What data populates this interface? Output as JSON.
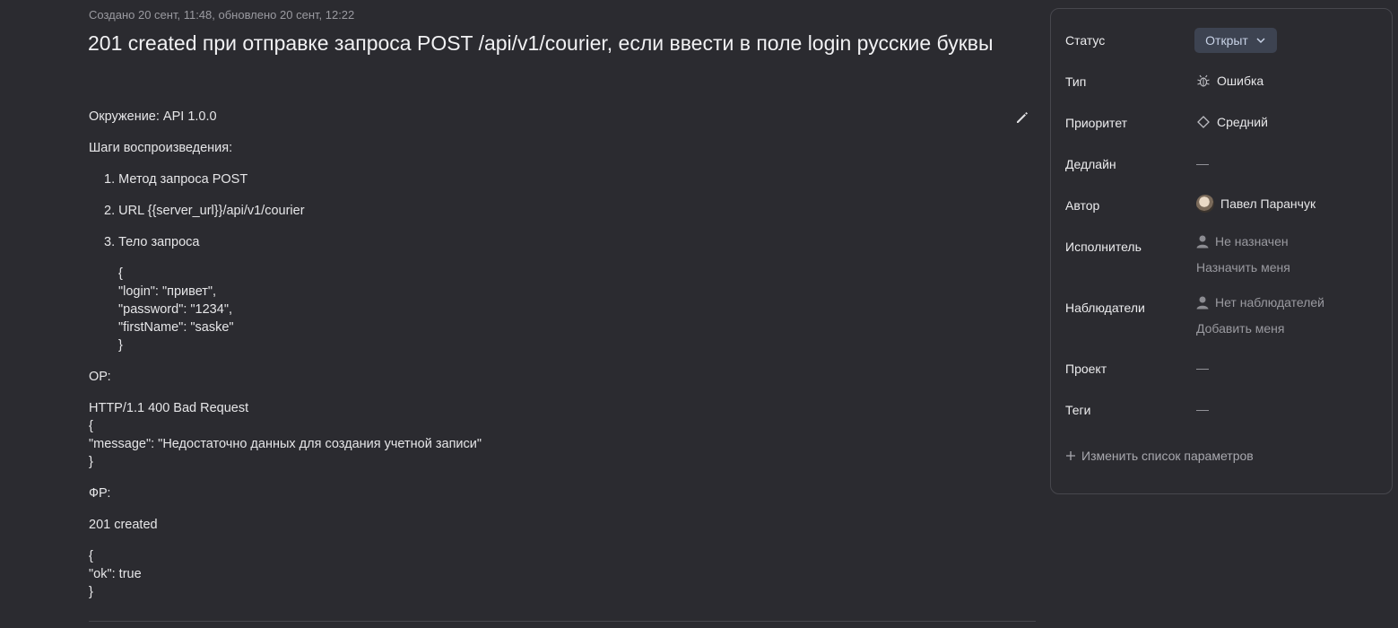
{
  "meta": "Создано 20 сент, 11:48, обновлено 20 сент, 12:22",
  "title": "201 created при отправке запроса POST /api/v1/courier, если ввести в поле login русские буквы",
  "description": {
    "environment": "Окружение: API 1.0.0",
    "steps_label": "Шаги воспроизведения:",
    "steps": [
      "1. Метод запроса POST",
      "2. URL {{server_url}}/api/v1/courier",
      "3. Тело запроса"
    ],
    "request_body": [
      "{",
      "\"login\": \"привет\",",
      "\"password\": \"1234\",",
      "\"firstName\": \"saske\"",
      "}"
    ],
    "actual_label": "ОР:",
    "actual": [
      "HTTP/1.1 400 Bad Request",
      "{",
      "\"message\": \"Недостаточно данных для создания учетной записи\"",
      "}"
    ],
    "expected_label": "ФР:",
    "expected_status": "201 created",
    "expected_body": [
      "{",
      "\"ok\": true",
      "}"
    ]
  },
  "panel": {
    "status_label": "Статус",
    "status_value": "Открыт",
    "type_label": "Тип",
    "type_value": "Ошибка",
    "priority_label": "Приоритет",
    "priority_value": "Средний",
    "deadline_label": "Дедлайн",
    "deadline_value": "—",
    "author_label": "Автор",
    "author_value": "Павел Паранчук",
    "assignee_label": "Исполнитель",
    "assignee_value": "Не назначен",
    "assign_me": "Назначить меня",
    "watchers_label": "Наблюдатели",
    "watchers_value": "Нет наблюдателей",
    "add_me": "Добавить меня",
    "project_label": "Проект",
    "project_value": "—",
    "tags_label": "Теги",
    "tags_value": "—",
    "change_params": "Изменить список параметров"
  }
}
